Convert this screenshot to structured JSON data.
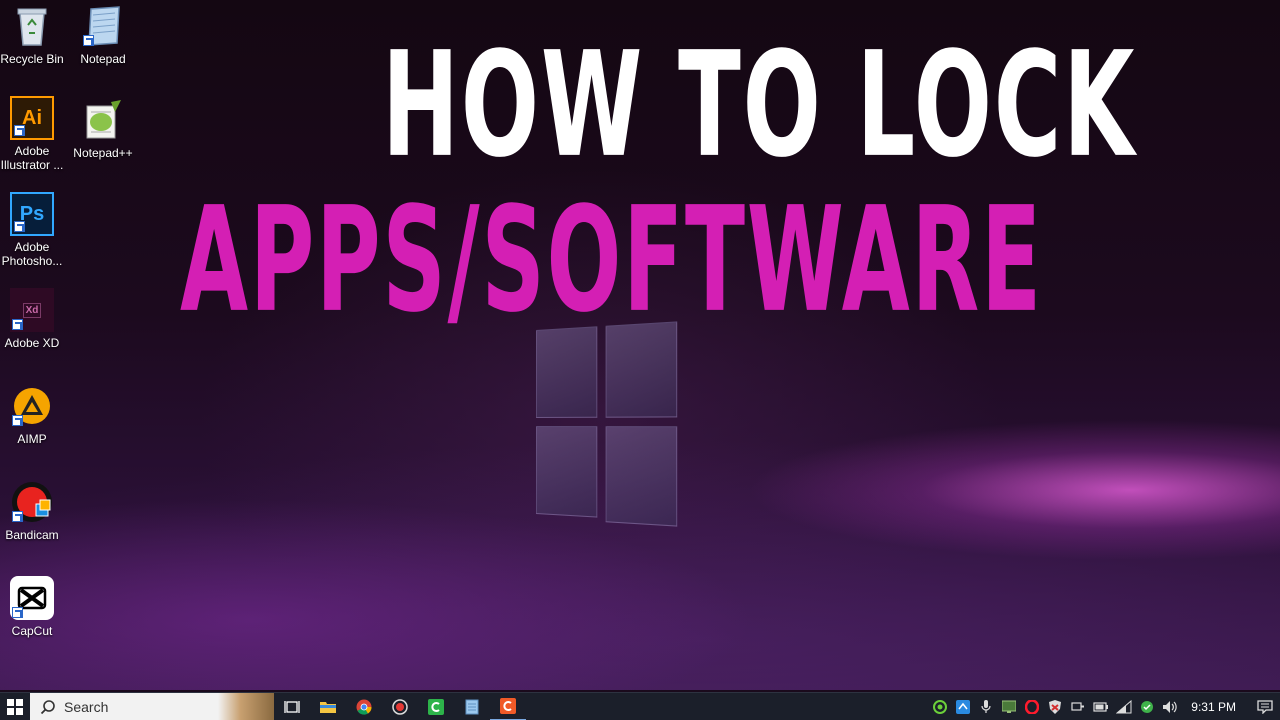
{
  "headline": {
    "line1": "HOW TO LOCK",
    "line2": "APPS/SOFTWARE",
    "line1_color": "#ffffff",
    "line2_color": "#d41fb4"
  },
  "desktop_icons": [
    {
      "label": "Recycle Bin",
      "icon": "recycle-bin-icon"
    },
    {
      "label": "Notepad",
      "icon": "notepad-icon"
    },
    {
      "label": "Adobe Illustrator ...",
      "icon": "adobe-illustrator-icon",
      "glyph": "Ai"
    },
    {
      "label": "Notepad++",
      "icon": "notepad-plus-plus-icon"
    },
    {
      "label": "Adobe Photosho...",
      "icon": "adobe-photoshop-icon",
      "glyph": "Ps"
    },
    {
      "label": "Adobe XD",
      "icon": "adobe-xd-icon",
      "glyph": "Xd"
    },
    {
      "label": "AIMP",
      "icon": "aimp-icon"
    },
    {
      "label": "Bandicam",
      "icon": "bandicam-icon"
    },
    {
      "label": "CapCut",
      "icon": "capcut-icon"
    }
  ],
  "taskbar": {
    "search_placeholder": "Search",
    "clock": "9:31 PM",
    "pinned": [
      "task-view-icon",
      "file-explorer-icon",
      "chrome-icon",
      "record-icon",
      "camtasia-icon",
      "notepad-icon",
      "app-icon"
    ],
    "tray": [
      "green-circle-icon",
      "network-app-icon",
      "microphone-icon",
      "monitor-icon",
      "opera-icon",
      "security-icon",
      "usb-icon",
      "battery-icon",
      "wifi-icon",
      "chat-icon",
      "volume-icon"
    ]
  },
  "colors": {
    "accent_magenta": "#d41fb4",
    "taskbar_bg": "#1b1f2a"
  }
}
